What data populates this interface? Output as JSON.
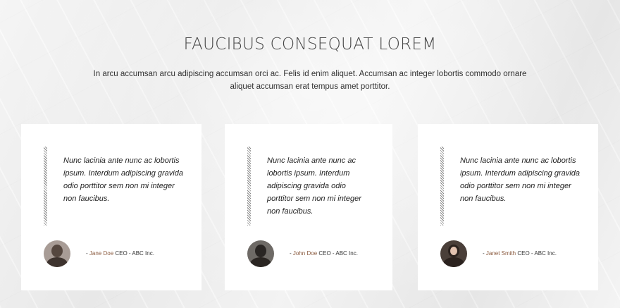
{
  "heading": "FAUCIBUS CONSEQUAT LOREM",
  "intro": "In arcu accumsan arcu adipiscing accumsan orci ac. Felis id enim aliquet. Accumsan ac integer lobortis commodo ornare aliquet accumsan erat tempus amet porttitor.",
  "testimonials": [
    {
      "quote": "Nunc lacinia ante nunc ac lobortis ipsum. Interdum adipiscing gravida odio porttitor sem non mi integer non faucibus.",
      "dash": "- ",
      "name": "Jane Doe",
      "role": " CEO - ABC Inc."
    },
    {
      "quote": "Nunc lacinia ante nunc ac lobortis ipsum. Interdum adipiscing gravida odio porttitor sem non mi integer non faucibus.",
      "dash": "- ",
      "name": "John Doe",
      "role": " CEO - ABC Inc."
    },
    {
      "quote": "Nunc lacinia ante nunc ac lobortis ipsum. Interdum adipiscing gravida odio porttitor sem non mi integer non faucibus.",
      "dash": "- ",
      "name": "Janet Smith",
      "role": " CEO - ABC Inc."
    }
  ]
}
